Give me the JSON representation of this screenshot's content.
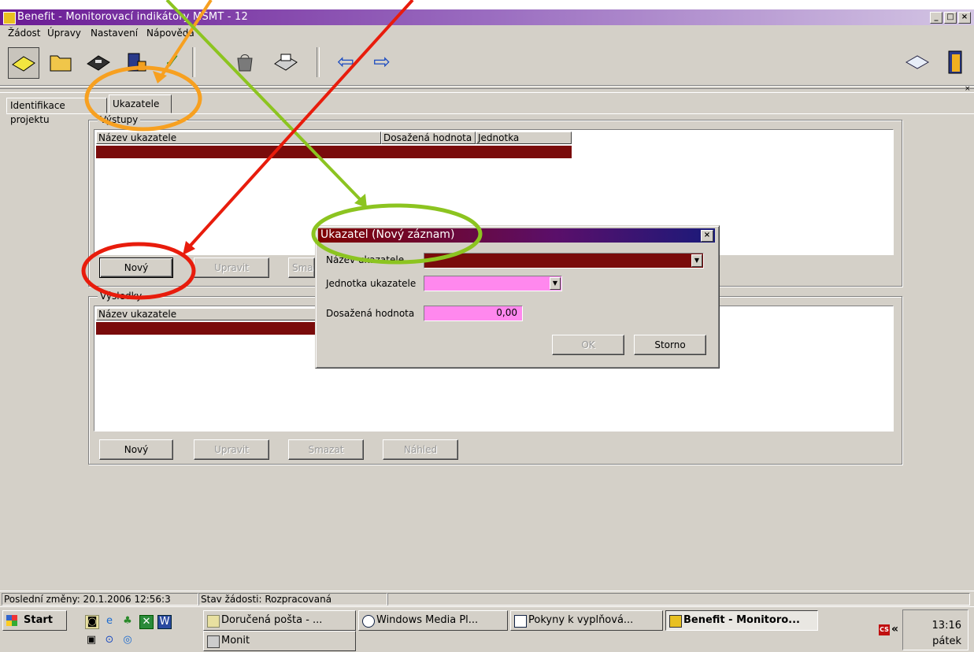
{
  "window": {
    "title": "Benefit - Monitorovací indikátory MŠMT - 12",
    "min": "_",
    "max": "□",
    "close": "×"
  },
  "menu": {
    "items": [
      "Žádost",
      "Úpravy",
      "Nastavení",
      "Nápověda"
    ]
  },
  "toolbar": {
    "icons": [
      "open-icon",
      "folder-icon",
      "save-icon",
      "print-icon",
      "check-icon",
      "bag-icon",
      "printer-icon",
      "back-icon",
      "forward-icon",
      "help-icon",
      "exit-icon"
    ],
    "check_glyph": "✓",
    "back_glyph": "⇦",
    "forward_glyph": "⇨"
  },
  "tabs": [
    "Identifikace projektu",
    "Ukazatele"
  ],
  "outputs": {
    "legend": "Výstupy",
    "columns": [
      "Název ukazatele",
      "Dosažená hodnota",
      "Jednotka"
    ],
    "buttons": [
      "Nový",
      "Upravit",
      "Smazat"
    ]
  },
  "results": {
    "legend": "Výsledky",
    "columns": [
      "Název ukazatele"
    ],
    "buttons": [
      "Nový",
      "Upravit",
      "Smazat",
      "Náhled"
    ]
  },
  "dialog": {
    "title": "Ukazatel (Nový záznam)",
    "close": "×",
    "fields": {
      "name_label": "Název ukazatele",
      "unit_label": "Jednotka ukazatele",
      "value_label": "Dosažená hodnota",
      "value": "0,00"
    },
    "ok": "OK",
    "cancel": "Storno"
  },
  "status": {
    "last_changes": "Poslední změny: 20.1.2006 12:56:3",
    "state": "Stav žádosti: Rozpracovaná"
  },
  "taskbar": {
    "start": "Start",
    "tasks": [
      "Doručená pošta - ...",
      "Windows Media Pl...",
      "Pokyny k vyplňová...",
      "Benefit - Monitoro...",
      "Monit"
    ],
    "lang": "CS",
    "chevron": "«",
    "time": "13:16",
    "day": "pátek"
  },
  "colors": {
    "annotation_orange": "#f7a020",
    "annotation_green": "#8cc420",
    "annotation_red": "#e81c0c",
    "grid_row": "#7a0b0b",
    "field_pink": "#ff88ee"
  }
}
